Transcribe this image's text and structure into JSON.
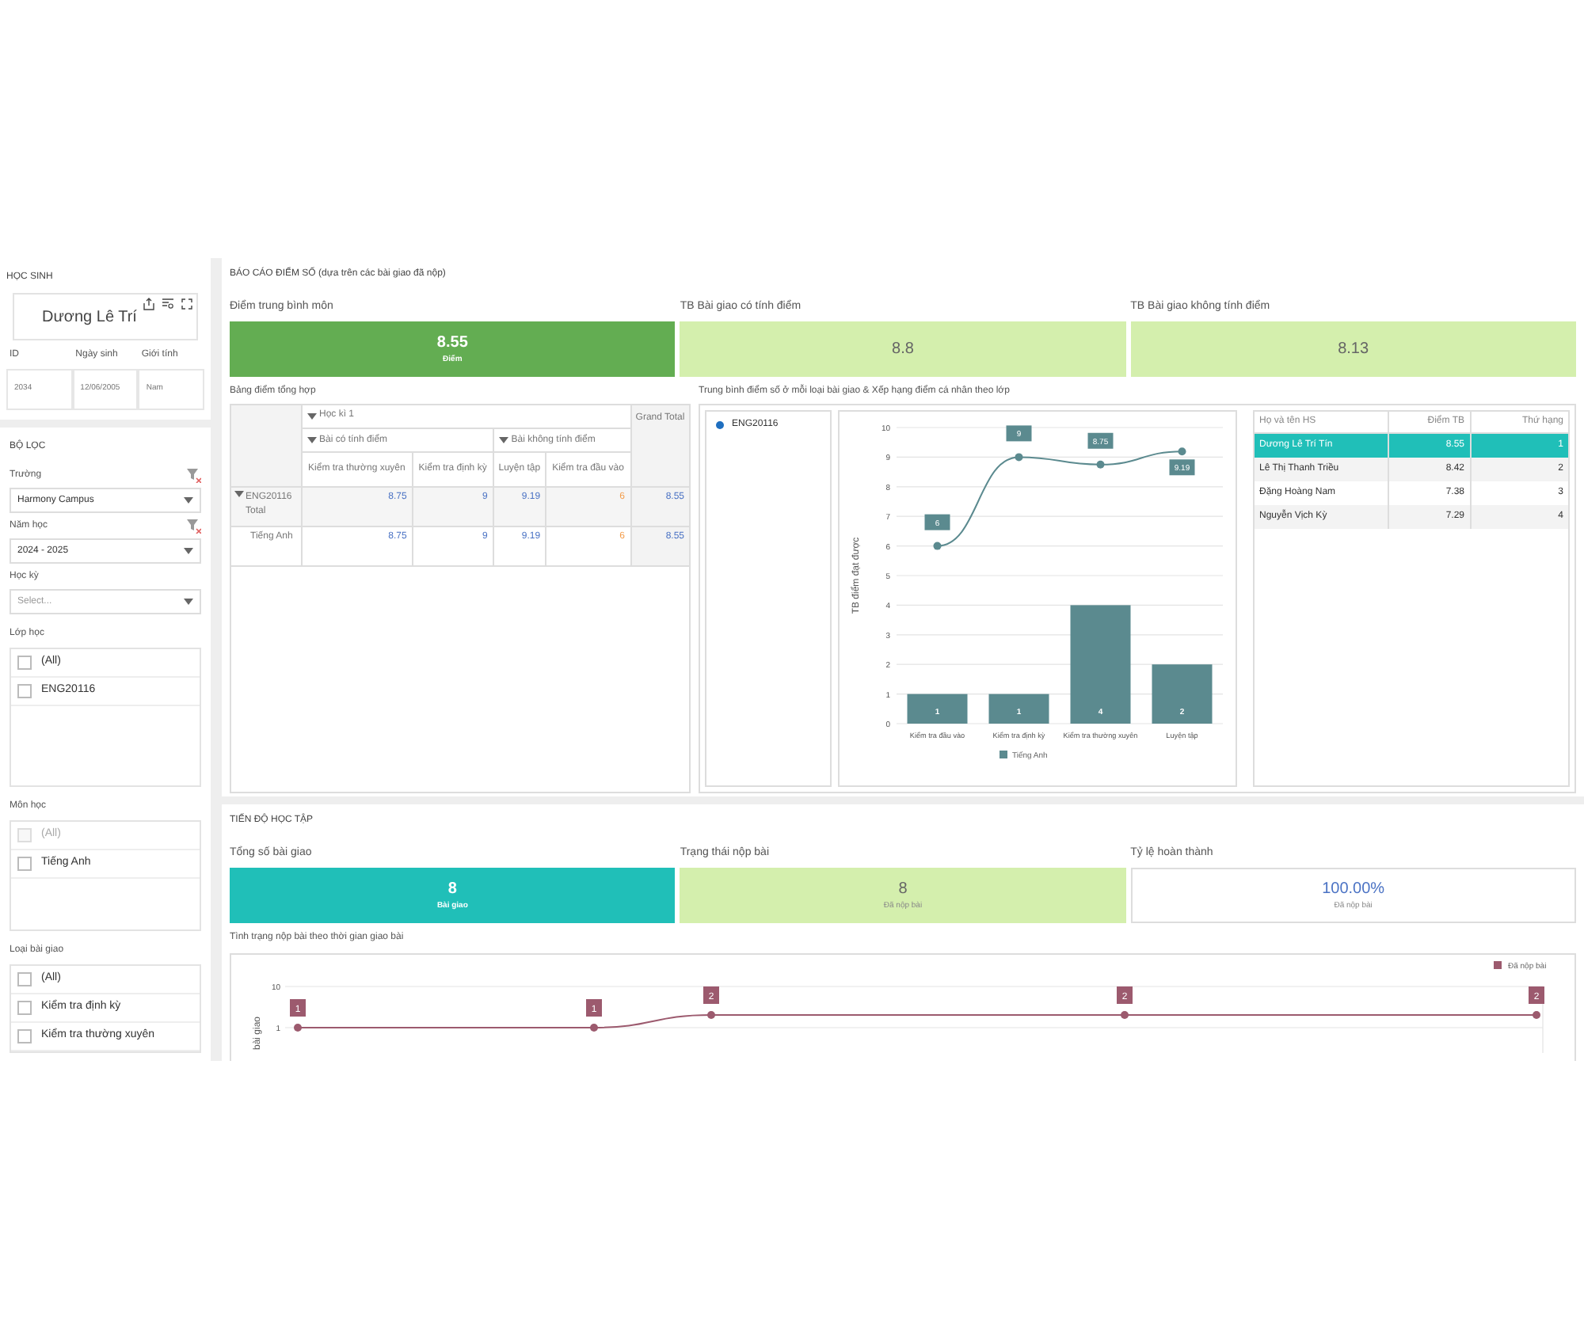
{
  "student": {
    "title": "HỌC SINH",
    "name": "Dương Lê Trí",
    "fields": [
      {
        "label": "ID",
        "value": "2034"
      },
      {
        "label": "Ngày sinh",
        "value": "12/06/2005"
      },
      {
        "label": "Giới tính",
        "value": "Nam"
      }
    ]
  },
  "filters": {
    "title": "BỘ LỌC",
    "selects": [
      {
        "label": "Trường",
        "value": "Harmony Campus",
        "clearable": true
      },
      {
        "label": "Năm học",
        "value": "2024 - 2025",
        "clearable": true
      },
      {
        "label": "Học kỳ",
        "placeholder": "Select...",
        "clearable": false
      }
    ],
    "lists": [
      {
        "label": "Lớp học",
        "items": [
          {
            "label": "(All)",
            "checked": false,
            "disabled": false
          },
          {
            "label": "ENG20116",
            "checked": false,
            "disabled": false
          }
        ]
      },
      {
        "label": "Môn học",
        "items": [
          {
            "label": "(All)",
            "checked": false,
            "disabled": true
          },
          {
            "label": "Tiếng Anh",
            "checked": false,
            "disabled": false
          }
        ]
      },
      {
        "label": "Loại bài giao",
        "items": [
          {
            "label": "(All)",
            "checked": false,
            "disabled": false
          },
          {
            "label": "Kiểm tra định kỳ",
            "checked": false,
            "disabled": false
          },
          {
            "label": "Kiểm tra thường xuyên",
            "checked": false,
            "disabled": false
          }
        ]
      }
    ]
  },
  "report": {
    "title": "BÁO CÁO ĐIỂM SỐ (dựa trên các bài giao đã nộp)",
    "kpis": [
      {
        "label": "Điểm trung bình môn",
        "value": "8.55",
        "unit": "Điểm",
        "color": "#63ad52",
        "kind": "filled"
      },
      {
        "label": "TB Bài giao có tính điểm",
        "value": "8.8",
        "color": "#d4efad",
        "kind": "plain"
      },
      {
        "label": "TB Bài giao không tính điểm",
        "value": "8.13",
        "color": "#d4efad",
        "kind": "plain"
      }
    ],
    "pivot": {
      "title": "Bảng điểm tổng hợp",
      "semester": "Học kì 1",
      "grand_total": "Grand Total",
      "groups": [
        {
          "label": "Bài có tính điểm",
          "columns": [
            "Kiểm tra thường xuyên",
            "Kiểm tra định kỳ"
          ]
        },
        {
          "label": "Bài không tính điểm",
          "columns": [
            "Luyện tập",
            "Kiểm tra đầu vào"
          ]
        }
      ],
      "rows": [
        {
          "label": "ENG20116 Total",
          "expanded": true,
          "cells": [
            {
              "value": "8.75",
              "color": "#4a72c4"
            },
            {
              "value": "9",
              "color": "#4a72c4"
            },
            {
              "value": "9.19",
              "color": "#4a72c4"
            },
            {
              "value": "6",
              "color": "#f39c4a"
            }
          ],
          "total": "8.55",
          "children": [
            {
              "label": "Tiếng Anh",
              "cells": [
                {
                  "value": "8.75",
                  "color": "#4a72c4"
                },
                {
                  "value": "9",
                  "color": "#4a72c4"
                },
                {
                  "value": "9.19",
                  "color": "#4a72c4"
                },
                {
                  "value": "6",
                  "color": "#f39c4a"
                }
              ],
              "total": "8.55"
            }
          ]
        }
      ]
    },
    "chart_panel": {
      "title": "Trung bình điểm số ở mỗi loại bài giao & Xếp hạng điểm cá nhân theo lớp",
      "legend": [
        {
          "label": "ENG20116",
          "color": "#1f6fc0"
        }
      ],
      "chart_data": {
        "type": "bar",
        "grid": true,
        "ylabel": "TB điểm đạt được",
        "categories": [
          "Kiểm tra đầu vào",
          "Kiểm tra định kỳ",
          "Kiểm tra thường xuyên",
          "Luyện tập"
        ],
        "ylim": [
          0,
          10
        ],
        "yticks": [
          0,
          1,
          2,
          3,
          4,
          5,
          6,
          7,
          8,
          9,
          10
        ],
        "data_labels": true,
        "series": [
          {
            "name": "Tiếng Anh",
            "type": "bar",
            "color": "#5b8a8f",
            "values": [
              1,
              1,
              4,
              2
            ]
          },
          {
            "type": "line",
            "marker": true,
            "color": "#5b8a8f",
            "values": [
              6,
              9,
              8.75,
              9.19
            ]
          }
        ]
      },
      "ranking": {
        "columns": [
          "Họ và tên HS",
          "Điểm TB",
          "Thứ hạng"
        ],
        "rows": [
          {
            "name": "Dương Lê Trí Tín",
            "score": "8.55",
            "rank": "1",
            "selected": true
          },
          {
            "name": "Lê Thị Thanh Triều",
            "score": "8.42",
            "rank": "2",
            "selected": false
          },
          {
            "name": "Đặng Hoàng Nam",
            "score": "7.38",
            "rank": "3",
            "selected": false
          },
          {
            "name": "Nguyễn Vịch Kỳ",
            "score": "7.29",
            "rank": "4",
            "selected": false
          }
        ]
      }
    }
  },
  "progress": {
    "title": "TIẾN ĐỘ HỌC TẬP",
    "kpis": [
      {
        "label": "Tổng số bài giao",
        "value": "8",
        "unit": "Bài giao",
        "color": "#20bfb8",
        "kind": "filled"
      },
      {
        "label": "Trạng thái nộp bài",
        "value": "8",
        "unit": "Đã nộp bài",
        "color": "#d4efad",
        "kind": "plain"
      },
      {
        "label": "Tỷ lệ hoàn thành",
        "value": "100.00%",
        "unit": "Đã nộp bài",
        "color": "#ffffff",
        "kind": "accent"
      }
    ],
    "timeline": {
      "title": "Tình trạng nộp bài theo thời gian giao bài",
      "axis_title": "bài giao",
      "ticks": [
        "10",
        "1"
      ],
      "legend": "Đã nộp bài",
      "point_labels": [
        "1",
        "1",
        "2",
        "2",
        "2"
      ]
    }
  }
}
